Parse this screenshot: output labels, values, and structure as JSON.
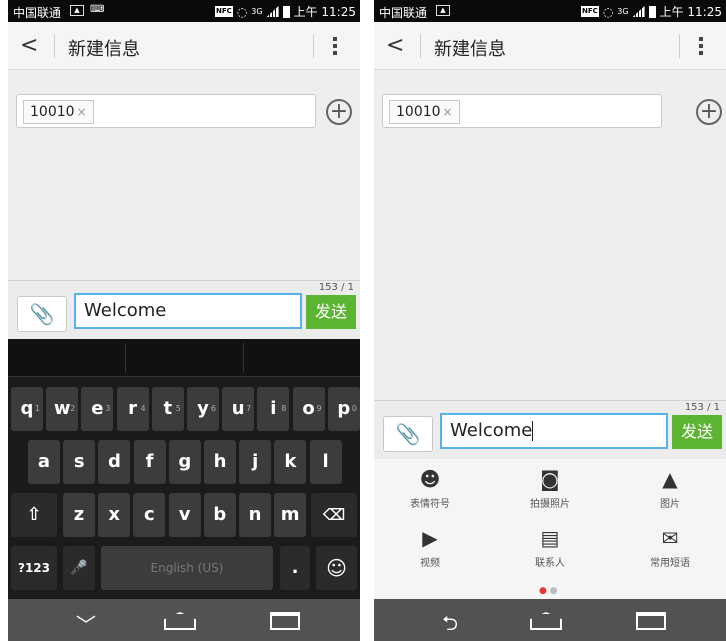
{
  "status": {
    "carrier": "中国联通",
    "nfc": "NFC",
    "network": "3G",
    "time": "上午 11:25"
  },
  "actionbar": {
    "back": "<",
    "title": "新建信息"
  },
  "recipient": {
    "chip": "10010",
    "remove": "×",
    "add": "+"
  },
  "composer": {
    "counter": "153 / 1",
    "text": "Welcome",
    "send": "发送"
  },
  "keyboard": {
    "row1": [
      "q",
      "w",
      "e",
      "r",
      "t",
      "y",
      "u",
      "i",
      "o",
      "p"
    ],
    "row1_hints": [
      "1",
      "2",
      "3",
      "4",
      "5",
      "6",
      "7",
      "8",
      "9",
      "0"
    ],
    "row2": [
      "a",
      "s",
      "d",
      "f",
      "g",
      "h",
      "j",
      "k",
      "l"
    ],
    "row3": [
      "z",
      "x",
      "c",
      "v",
      "b",
      "n",
      "m"
    ],
    "shift": "⇧",
    "delete": "⌫",
    "symbols": "?123",
    "mic": "🎤",
    "space": "English (US)",
    "period": ".",
    "emoji": "☺"
  },
  "nav": {
    "down": "﹀",
    "back": "⮌",
    "home": "⌂",
    "recent": "▭"
  },
  "panel": {
    "items": [
      {
        "label": "表情符号",
        "icon": "smiley-icon",
        "glyph": "☻"
      },
      {
        "label": "拍摄照片",
        "icon": "camera-icon",
        "glyph": "◙"
      },
      {
        "label": "图片",
        "icon": "picture-icon",
        "glyph": "▲"
      },
      {
        "label": "视频",
        "icon": "video-icon",
        "glyph": "▶"
      },
      {
        "label": "联系人",
        "icon": "contact-card-icon",
        "glyph": "▤"
      },
      {
        "label": "常用短语",
        "icon": "phrases-icon",
        "glyph": "✉"
      }
    ],
    "dots": "● ●"
  },
  "colors": {
    "send_green": "#5cb532",
    "input_border": "#55b2ea",
    "keyboard_bg": "#1b1b1b"
  }
}
